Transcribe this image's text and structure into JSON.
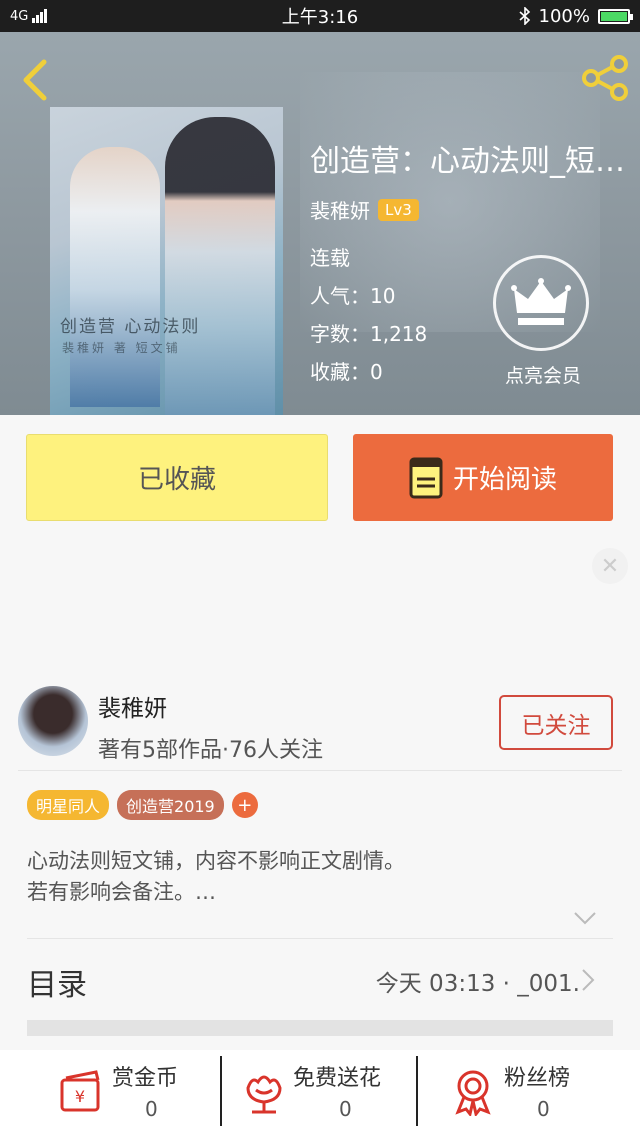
{
  "status_bar": {
    "signal": "4G",
    "time": "上午3:16",
    "battery": "100%"
  },
  "book": {
    "title": "创造营：心动法则_短…",
    "author": "裴稚妍",
    "level": "Lv3",
    "status": "连载",
    "popularity": "人气：10",
    "word_count": "字数：1,218",
    "favorites": "收藏：0",
    "cover_text_1": "创造营 心动法则",
    "cover_text_2": "裴稚妍 著  短文铺"
  },
  "vip": {
    "label": "点亮会员"
  },
  "actions": {
    "favorited_label": "已收藏",
    "read_label": "开始阅读"
  },
  "author_card": {
    "name": "裴稚妍",
    "stats": "著有5部作品·76人关注",
    "follow_label": "已关注"
  },
  "tags": [
    {
      "label": "明星同人",
      "color": "#f5b731"
    },
    {
      "label": "创造营2019",
      "color": "#c67058"
    }
  ],
  "tag_add": "+",
  "description": {
    "line1": "心动法则短文铺，内容不影响正文剧情。",
    "line2": "若有影响会备注。…"
  },
  "toc": {
    "title": "目录",
    "latest": "今天 03:13 · _001."
  },
  "bottom": [
    {
      "label": "赏金币",
      "count": "0"
    },
    {
      "label": "免费送花",
      "count": "0"
    },
    {
      "label": "粉丝榜",
      "count": "0"
    }
  ],
  "colors": {
    "accent": "#ec6b3e",
    "favorite_bg": "#fef27e",
    "follow_red": "#d14a3d",
    "icon_red": "#d9342b"
  }
}
